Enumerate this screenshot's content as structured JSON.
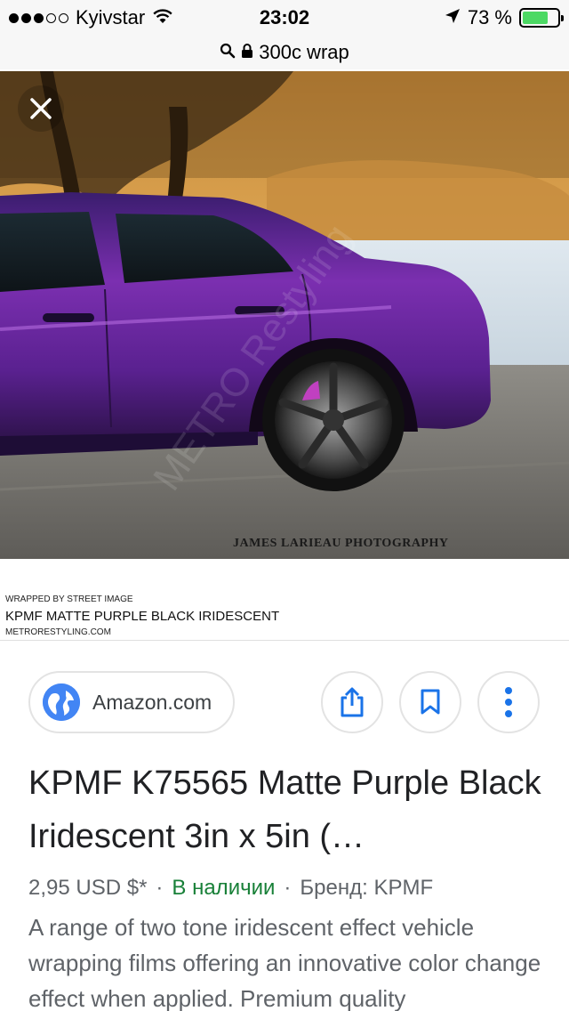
{
  "status_bar": {
    "carrier": "Kyivstar",
    "time": "23:02",
    "battery": "73 %",
    "battery_level": 0.73
  },
  "url_bar": {
    "text": "300c wrap"
  },
  "image": {
    "photo_credit": "JAMES LARIEAU PHOTOGRAPHY",
    "caption_top": "WRAPPED BY STREET IMAGE",
    "caption_main": "KPMF MATTE PURPLE BLACK IRIDESCENT",
    "caption_bottom": "METRORESTYLING.COM"
  },
  "source": {
    "label": "Amazon.com"
  },
  "result": {
    "title": "KPMF K75565 Matte Purple Black Iridescent 3in x 5in (…",
    "price": "2,95 USD $*",
    "availability": "В наличии",
    "brand": "Бренд: KPMF",
    "description": "A range of two tone iridescent effect vehicle wrapping films offering an innovative color change effect when applied. Premium quality"
  },
  "colors": {
    "link_blue": "#4285f4",
    "stock_green": "#188038",
    "battery_green": "#4cd964"
  }
}
